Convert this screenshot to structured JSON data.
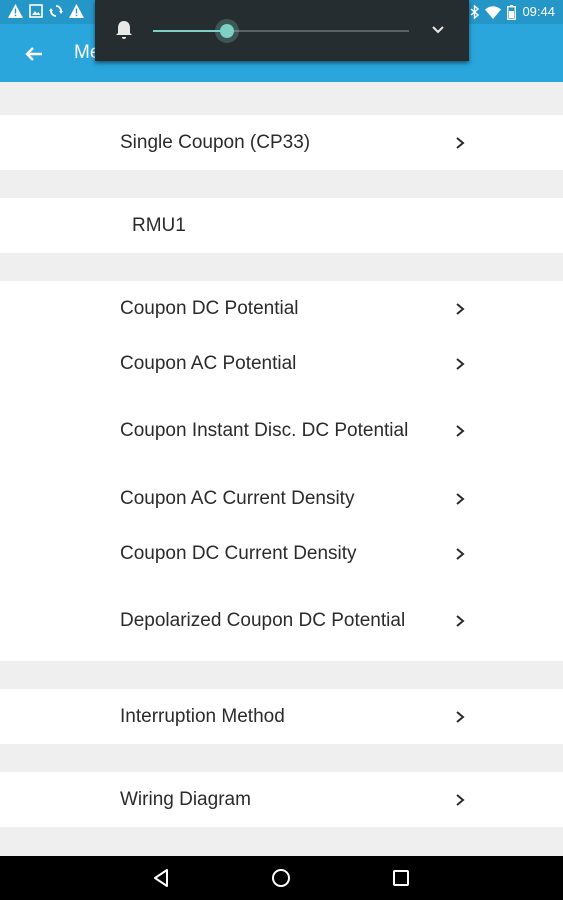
{
  "status_bar": {
    "time": "09:44",
    "left_icons": [
      "warning-icon",
      "image-icon",
      "sync-icon",
      "warning-icon"
    ],
    "right_icons": [
      "bluetooth-icon",
      "wifi-icon",
      "battery-icon"
    ]
  },
  "app_bar": {
    "title": "Me",
    "back_icon": "arrow-left-icon",
    "color": "#2aa6dc"
  },
  "sections": [
    {
      "rows": [
        {
          "label": "Single Coupon (CP33)",
          "chevron": true
        }
      ]
    },
    {
      "rows": [
        {
          "label": "RMU1",
          "chevron": false
        }
      ]
    },
    {
      "rows": [
        {
          "label": "Coupon DC Potential",
          "chevron": true
        },
        {
          "label": "Coupon AC Potential",
          "chevron": true
        },
        {
          "label": "Coupon Instant Disc. DC Potential",
          "chevron": true
        },
        {
          "label": "Coupon AC Current Density",
          "chevron": true
        },
        {
          "label": "Coupon DC Current Density",
          "chevron": true
        },
        {
          "label": "Depolarized Coupon DC Potential",
          "chevron": true
        }
      ]
    },
    {
      "rows": [
        {
          "label": "Interruption Method",
          "chevron": true
        }
      ]
    },
    {
      "rows": [
        {
          "label": "Wiring Diagram",
          "chevron": true
        }
      ]
    }
  ],
  "volume_panel": {
    "icon": "bell-icon",
    "level": 0.29,
    "expand_icon": "chevron-down-icon",
    "accent": "#7ecfc4"
  },
  "nav_bar": {
    "buttons": [
      "back-triangle-icon",
      "home-circle-icon",
      "recents-square-icon"
    ]
  }
}
